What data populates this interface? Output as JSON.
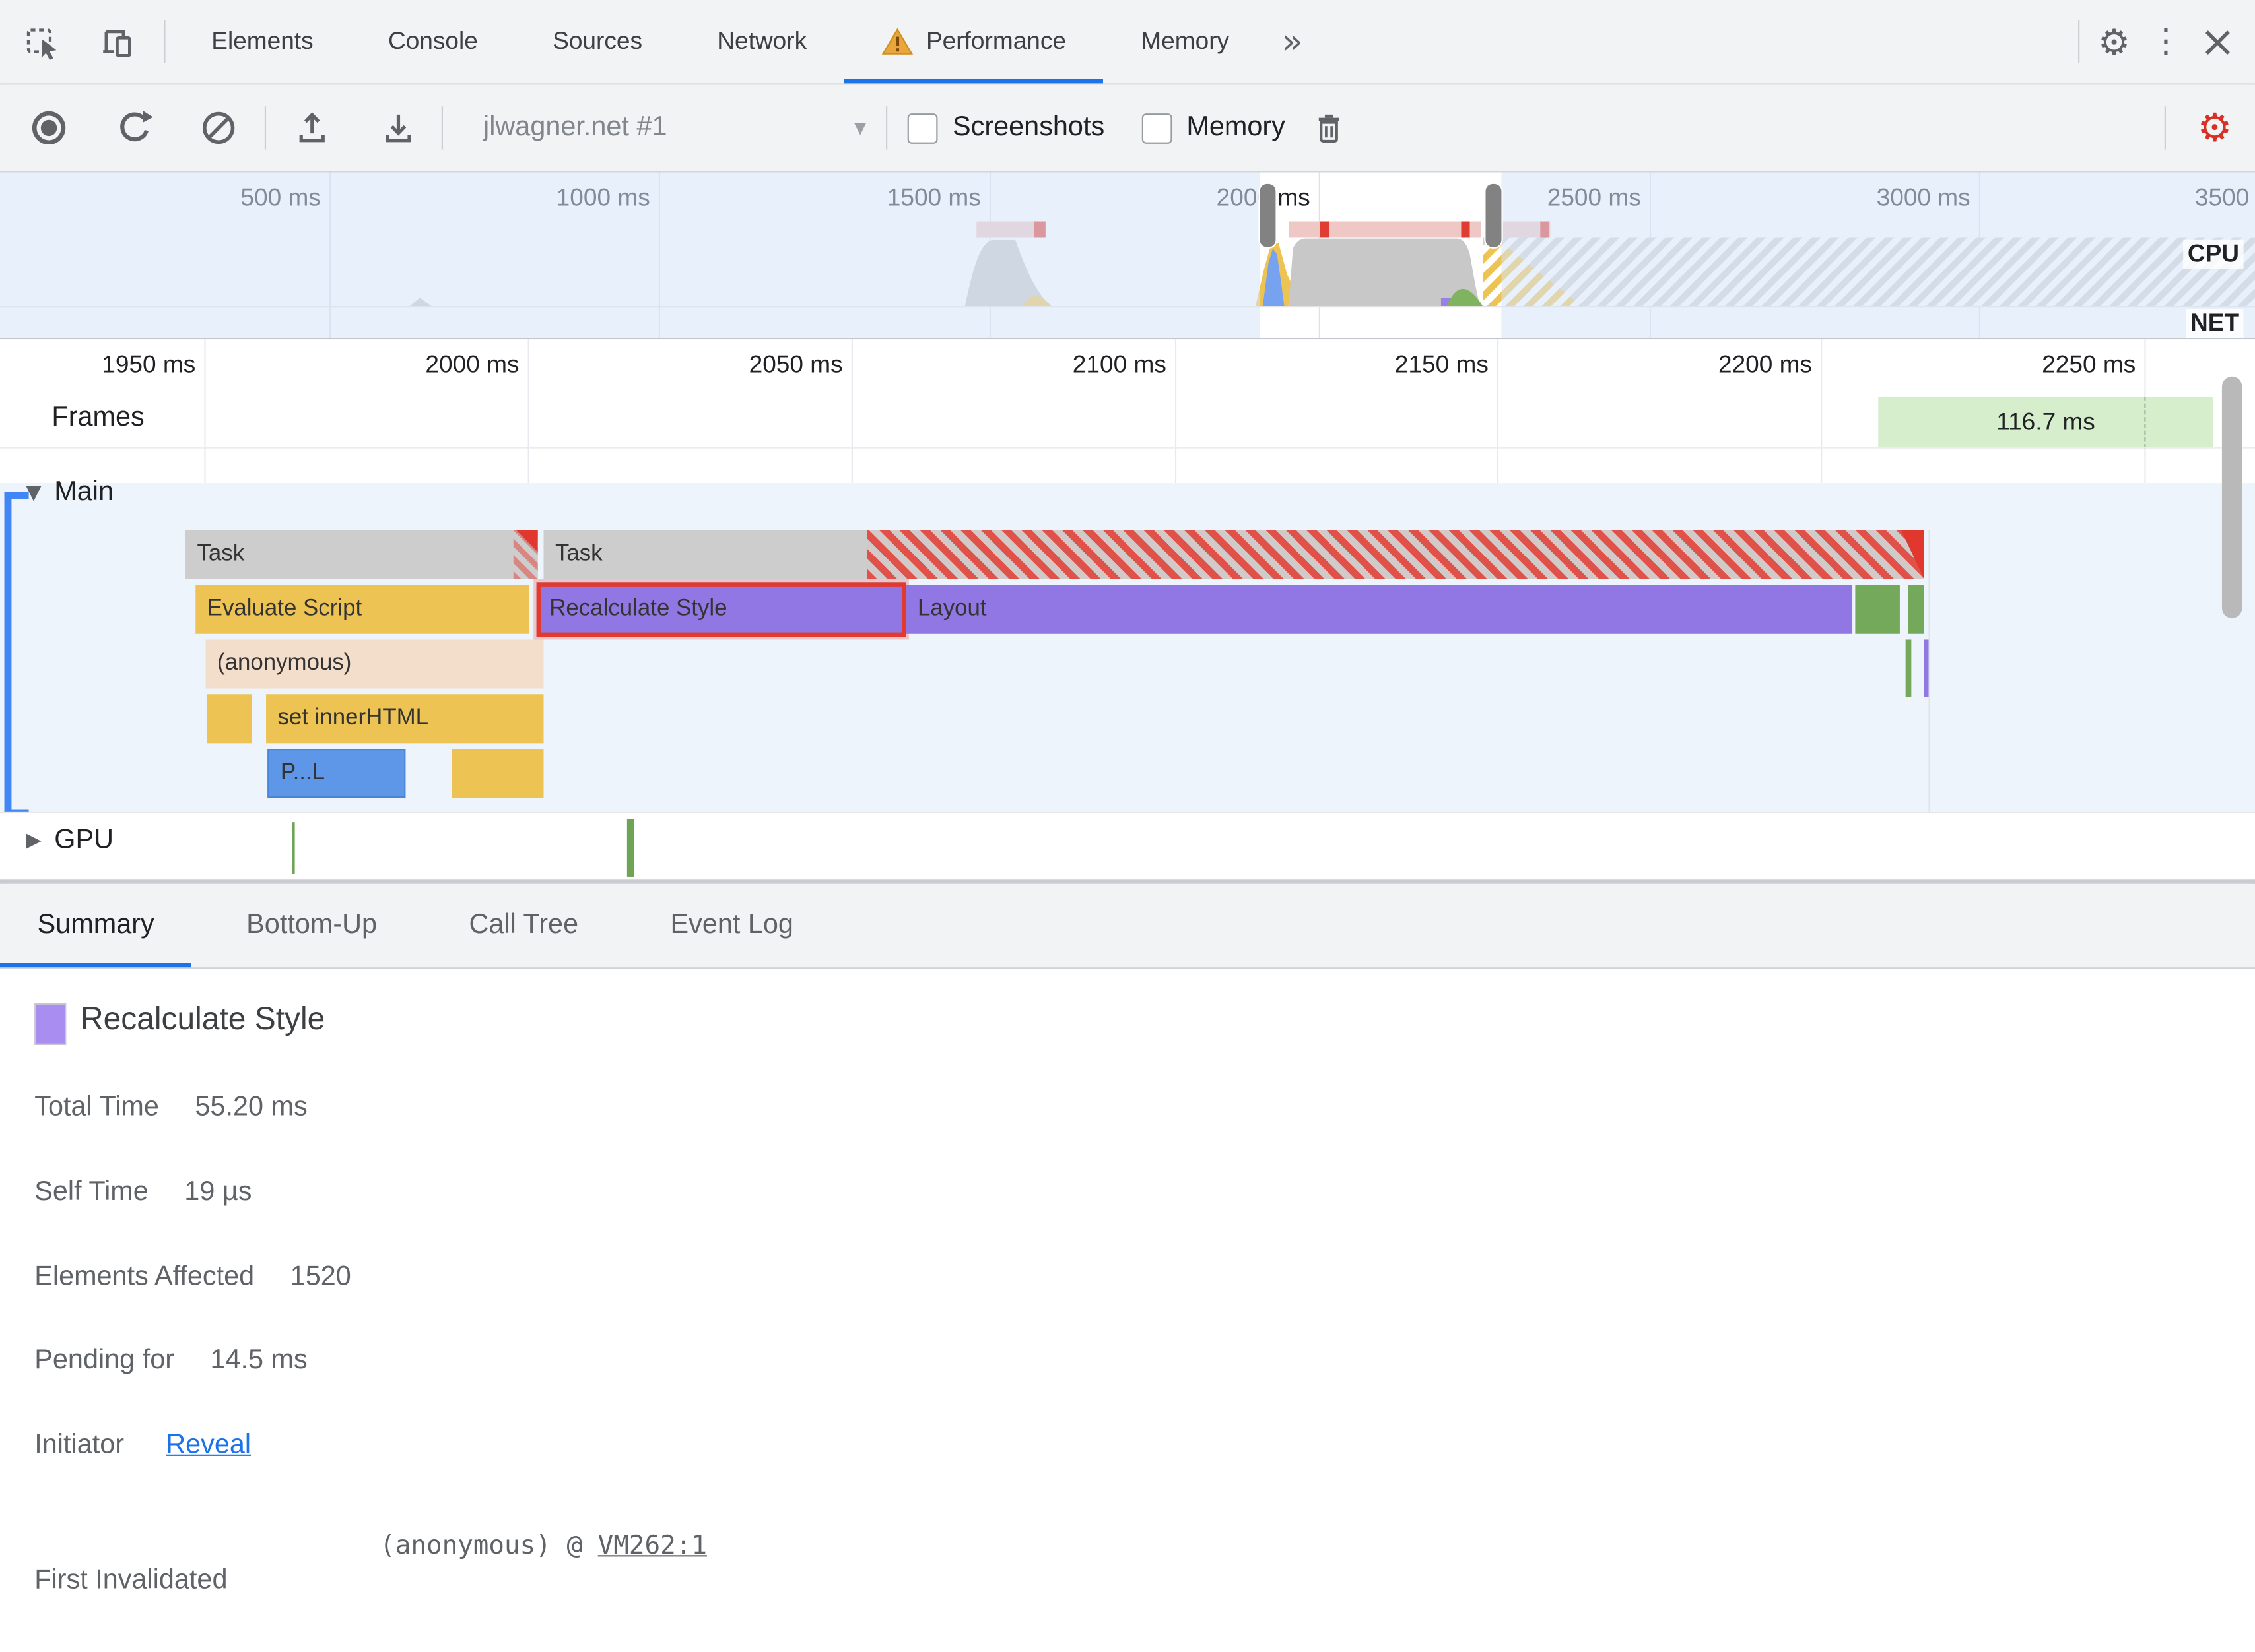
{
  "top_tabs": {
    "elements": "Elements",
    "console": "Console",
    "sources": "Sources",
    "network": "Network",
    "performance": "Performance",
    "memory": "Memory",
    "active_tab": "Performance"
  },
  "icons": {
    "overflow": "»",
    "settings_gear": "⚙",
    "kebab_menu": "⋮",
    "close": "×",
    "dropdown_caret": "▾",
    "collapse_open": "▼",
    "collapse_closed": "▶"
  },
  "perf_toolbar": {
    "session": "jlwagner.net #1",
    "screenshots_label": "Screenshots",
    "screenshots_checked": false,
    "memory_label": "Memory",
    "memory_checked": false
  },
  "overview": {
    "ticks": [
      "500 ms",
      "1000 ms",
      "1500 ms",
      "2000 ms",
      "2500 ms",
      "3000 ms",
      "3500"
    ],
    "cpu_label": "CPU",
    "net_label": "NET"
  },
  "ruler": {
    "ticks": [
      "1950 ms",
      "2000 ms",
      "2050 ms",
      "2100 ms",
      "2150 ms",
      "2200 ms",
      "2250 ms"
    ]
  },
  "frames": {
    "label": "Frames",
    "frame_duration": "116.7 ms"
  },
  "main_track": {
    "label": "Main",
    "bars": {
      "task1": "Task",
      "task2": "Task",
      "evaluate_script": "Evaluate Script",
      "recalculate_style": "Recalculate Style",
      "layout": "Layout",
      "anonymous": "(anonymous)",
      "set_inner_html": "set innerHTML",
      "parse_html": "P...L"
    }
  },
  "gpu_track": {
    "label": "GPU"
  },
  "bottom_tabs": {
    "summary": "Summary",
    "bottom_up": "Bottom-Up",
    "call_tree": "Call Tree",
    "event_log": "Event Log",
    "active": "Summary"
  },
  "summary": {
    "title": "Recalculate Style",
    "rows": [
      {
        "label": "Total Time",
        "value": "55.20 ms"
      },
      {
        "label": "Self Time",
        "value": "19 µs"
      },
      {
        "label": "Elements Affected",
        "value": "1520"
      },
      {
        "label": "Pending for",
        "value": "14.5 ms"
      }
    ],
    "initiator_label": "Initiator",
    "initiator_link": "Reveal",
    "first_invalidated_label": "First Invalidated",
    "first_invalidated_value": "(anonymous) @ ",
    "first_invalidated_link": "VM262:1"
  },
  "colors": {
    "accent_blue": "#1a73e8",
    "warning_orange": "#eaa63d",
    "capture_settings_red": "#d93025",
    "task_gray": "#cdcdcd",
    "script_yellow": "#edc453",
    "style_purple": "#9177e3",
    "anonymous_peach": "#f3ddcb",
    "parse_blue": "#5e97e8",
    "paint_green": "#74a95c",
    "frame_green": "#d7eecd",
    "long_task_red": "#e13c31",
    "selection_pink": "#efc8c5"
  }
}
